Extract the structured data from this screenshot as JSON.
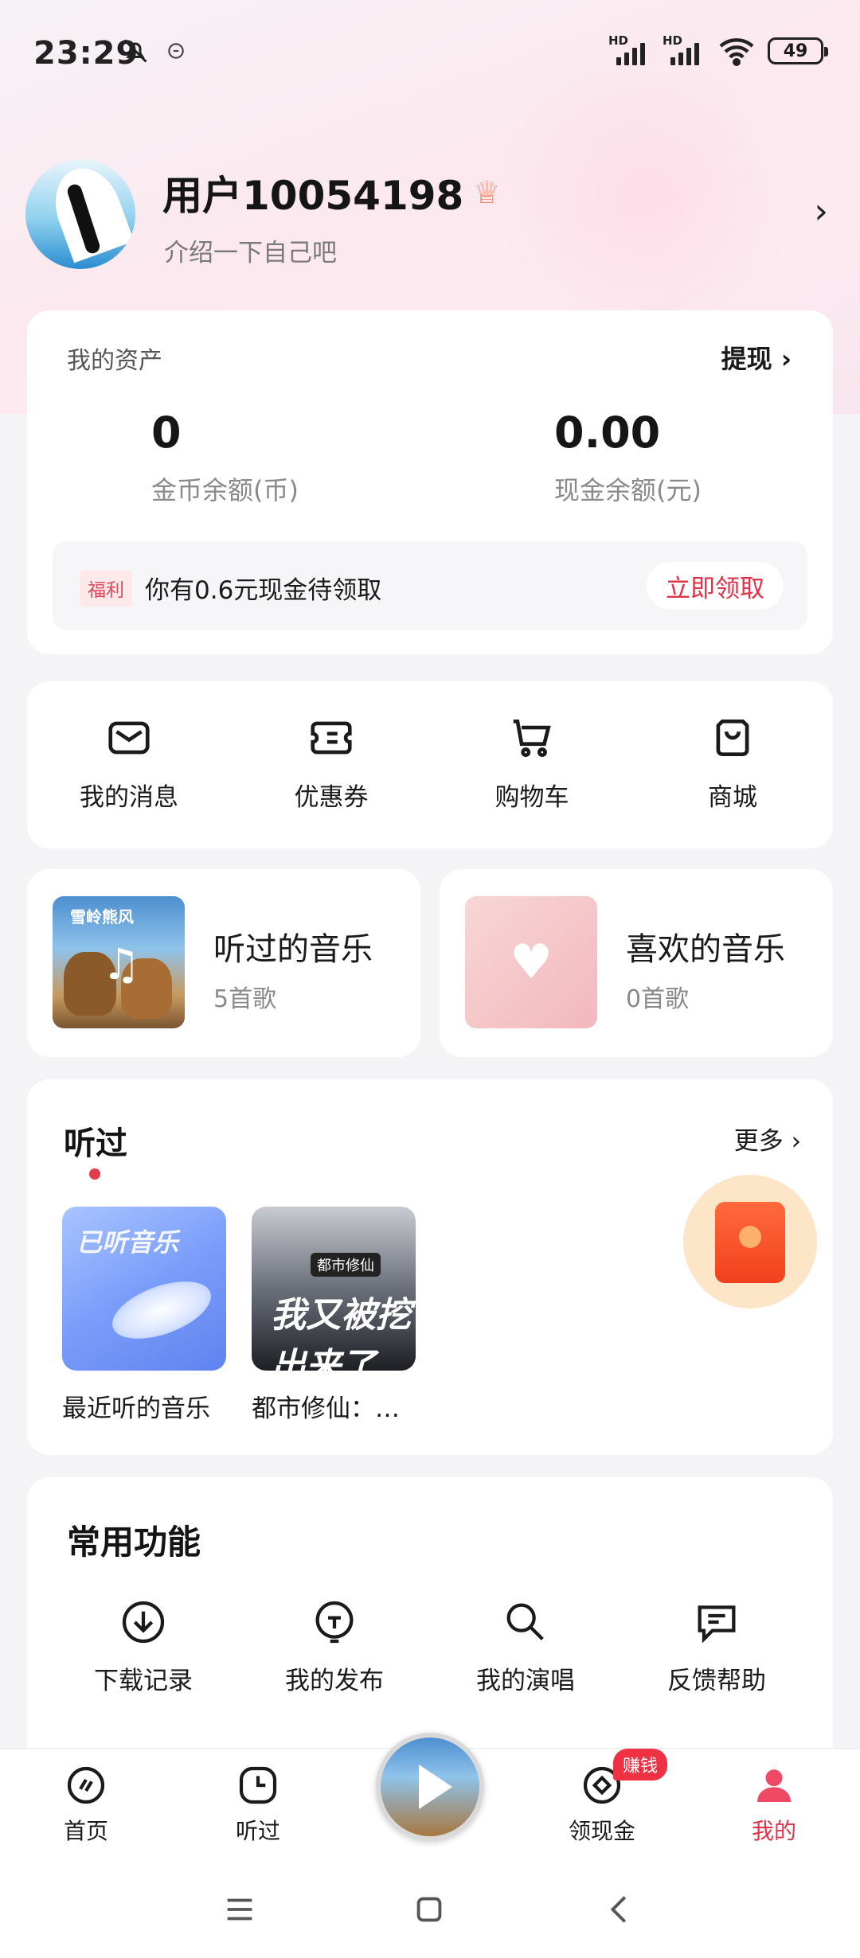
{
  "status_bar": {
    "time": "23:29",
    "battery": "49"
  },
  "profile": {
    "username": "用户10054198",
    "bio": "介绍一下自己吧"
  },
  "assets": {
    "title": "我的资产",
    "withdraw": "提现",
    "coins": {
      "value": "0",
      "label": "金币余额(币)"
    },
    "cash": {
      "value": "0.00",
      "label": "现金余额(元)"
    },
    "bonus": {
      "tag": "福利",
      "text": "你有0.6元现金待领取",
      "button": "立即领取"
    }
  },
  "quick_actions": [
    {
      "label": "我的消息",
      "icon": "mail-icon"
    },
    {
      "label": "优惠券",
      "icon": "coupon-icon"
    },
    {
      "label": "购物车",
      "icon": "cart-icon"
    },
    {
      "label": "商城",
      "icon": "shop-bag-icon"
    }
  ],
  "music_cards": {
    "listened": {
      "title": "听过的音乐",
      "count": "5首歌",
      "cover_text": "雪岭熊风"
    },
    "liked": {
      "title": "喜欢的音乐",
      "count": "0首歌"
    }
  },
  "recent": {
    "title": "听过",
    "more": "更多",
    "items": [
      {
        "label": "最近听的音乐",
        "cover_text": "已听音乐"
      },
      {
        "label": "都市修仙：…",
        "cover_badge": "都市修仙",
        "cover_text": "我又被挖出来了"
      }
    ]
  },
  "functions": {
    "title": "常用功能",
    "items": [
      {
        "label": "下载记录",
        "icon": "download-icon"
      },
      {
        "label": "我的发布",
        "icon": "publish-icon"
      },
      {
        "label": "我的演唱",
        "icon": "sing-icon"
      },
      {
        "label": "反馈帮助",
        "icon": "feedback-icon"
      }
    ]
  },
  "bottom_nav": {
    "items": [
      {
        "label": "首页",
        "icon": "home-icon"
      },
      {
        "label": "听过",
        "icon": "clock-icon"
      },
      {
        "label": "领现金",
        "icon": "cash-icon",
        "badge": "赚钱"
      },
      {
        "label": "我的",
        "icon": "user-icon",
        "active": true
      }
    ]
  },
  "colors": {
    "accent": "#e0334a",
    "background": "#f4f4f6"
  }
}
